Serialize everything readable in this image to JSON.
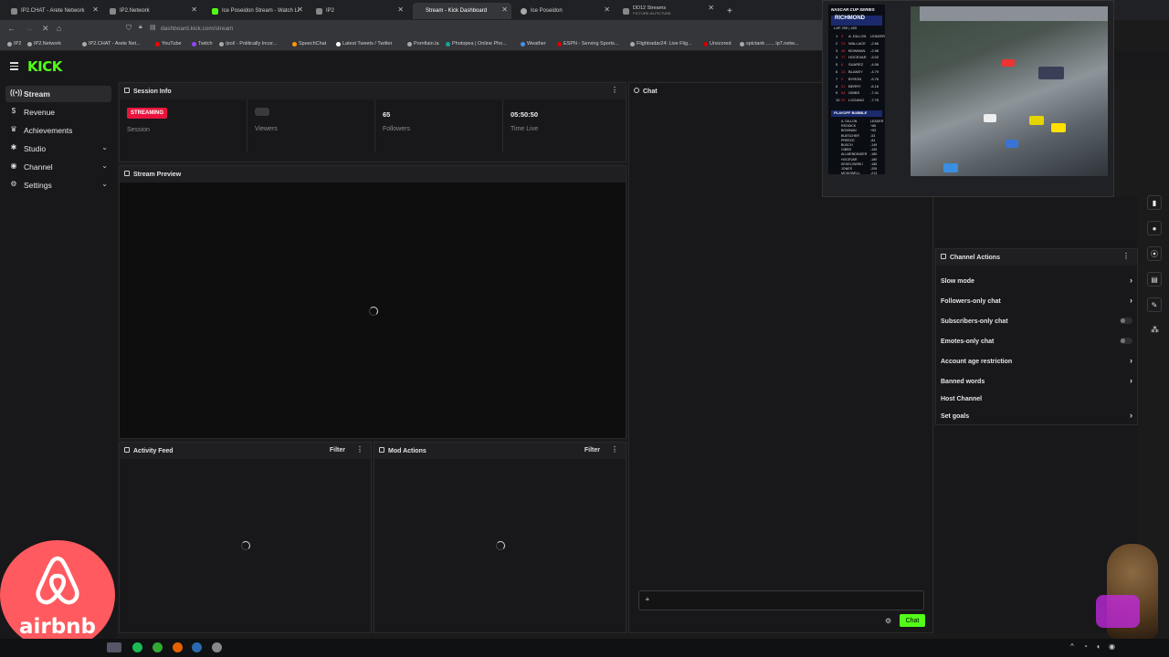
{
  "tabs": [
    {
      "label": "IP2.CHAT - Arete Network",
      "active": false
    },
    {
      "label": "IP2.Network",
      "active": false
    },
    {
      "label": "Ice Poseidon Stream - Watch Li",
      "active": false
    },
    {
      "label": "IP2",
      "active": false
    },
    {
      "label": "Stream - Kick Dashboard",
      "active": true
    },
    {
      "label": "Ice Poseidon",
      "active": false
    },
    {
      "label": "DD12 Streams",
      "sub": "PICTURE-IN-PICTURE",
      "active": false
    }
  ],
  "address": {
    "url": "dashboard.kick.com/stream"
  },
  "bookmarks": [
    "IP2",
    "IP2.Network",
    "IP2.CHAT - Arete Net...",
    "YouTube",
    "Twitch",
    "/pol/ - Politically Incor...",
    "SpeechChat",
    "Latest Tweets / Twitter",
    "Pornfiain.la",
    "Photopea | Online Pho...",
    "Weather",
    "ESPN - Serving Sports...",
    "Flightradar24: Live Flig...",
    "Unscored",
    "spictank ...... ip7.netw..."
  ],
  "header": {
    "logo": "KICK"
  },
  "sidebar": {
    "items": [
      {
        "label": "Stream",
        "icon": "broadcast-icon",
        "active": true,
        "expand": false
      },
      {
        "label": "Revenue",
        "icon": "dollar-icon",
        "active": false,
        "expand": false
      },
      {
        "label": "Achievements",
        "icon": "trophy-icon",
        "active": false,
        "expand": false
      },
      {
        "label": "Studio",
        "icon": "studio-icon",
        "active": false,
        "expand": true
      },
      {
        "label": "Channel",
        "icon": "channel-icon",
        "active": false,
        "expand": true
      },
      {
        "label": "Settings",
        "icon": "gear-icon",
        "active": false,
        "expand": true
      }
    ]
  },
  "session": {
    "title": "Session Info",
    "status_badge": "STREAMING",
    "session_label": "Session",
    "viewers_label": "Viewers",
    "followers_value": "65",
    "followers_label": "Followers",
    "time_value": "05:50:50",
    "time_label": "Time Live"
  },
  "preview": {
    "title": "Stream Preview"
  },
  "activity": {
    "title": "Activity Feed",
    "filter": "Filter"
  },
  "mod": {
    "title": "Mod Actions",
    "filter": "Filter"
  },
  "chat": {
    "title": "Chat",
    "send_label": "Chat"
  },
  "channel_actions": {
    "title": "Channel Actions",
    "items": [
      {
        "label": "Slow mode",
        "control": "chevron"
      },
      {
        "label": "Followers-only chat",
        "control": "chevron"
      },
      {
        "label": "Subscribers-only chat",
        "control": "toggle"
      },
      {
        "label": "Emotes-only chat",
        "control": "toggle"
      },
      {
        "label": "Account age restriction",
        "control": "chevron"
      },
      {
        "label": "Banned words",
        "control": "chevron"
      },
      {
        "label": "Host Channel",
        "control": "none"
      },
      {
        "label": "Set goals",
        "control": "chevron"
      }
    ]
  },
  "pip": {
    "series": "NASCAR CUP SERIES",
    "track": "RICHMOND",
    "lap": "LAP 259 | 400",
    "leaderboard": [
      {
        "pos": "1",
        "num": "3",
        "name": "A. DILLON",
        "gap": "LEADER"
      },
      {
        "pos": "2",
        "num": "23",
        "name": "WALLACE",
        "gap": "-2.66"
      },
      {
        "pos": "3",
        "num": "48",
        "name": "BOWMAN",
        "gap": "-2.96"
      },
      {
        "pos": "4",
        "num": "77",
        "name": "HOCEVAR",
        "gap": "-3.02"
      },
      {
        "pos": "5",
        "num": "6",
        "name": "SUAREZ",
        "gap": "-4.06"
      },
      {
        "pos": "6",
        "num": "12",
        "name": "BLANEY",
        "gap": "-4.79"
      },
      {
        "pos": "7",
        "num": "2",
        "name": "BYRON",
        "gap": "-5.76"
      },
      {
        "pos": "8",
        "num": "21",
        "name": "BERRY",
        "gap": "-6.16"
      },
      {
        "pos": "9",
        "num": "54",
        "name": "GIBBS",
        "gap": "-7.41"
      },
      {
        "pos": "10",
        "num": "22",
        "name": "LOGANO",
        "gap": "-7.75"
      }
    ],
    "bubble_title": "PLAYOFF BUBBLE",
    "bubble": [
      {
        "name": "A. DILLON",
        "val": "LEADER"
      },
      {
        "name": "REDDICK",
        "val": "+66"
      },
      {
        "name": "BOWMAN",
        "val": "+53"
      },
      {
        "name": "BUESCHER",
        "val": "-53"
      },
      {
        "name": "PREECE",
        "val": "-84"
      },
      {
        "name": "BUSCH",
        "val": "-149"
      },
      {
        "name": "GIBBS",
        "val": "-155"
      },
      {
        "name": "ALLMENDINGER",
        "val": "-180"
      },
      {
        "name": "HOCEVAR",
        "val": "-180"
      },
      {
        "name": "KESELOWSKI",
        "val": "-185"
      },
      {
        "name": "JONES",
        "val": "-205"
      },
      {
        "name": "MCDOWELL",
        "val": "-213"
      }
    ]
  },
  "ad": {
    "brand": "airbnb"
  },
  "colors": {
    "accent": "#53fc18",
    "live": "#e8143c",
    "airbnb": "#ff5a5f"
  }
}
